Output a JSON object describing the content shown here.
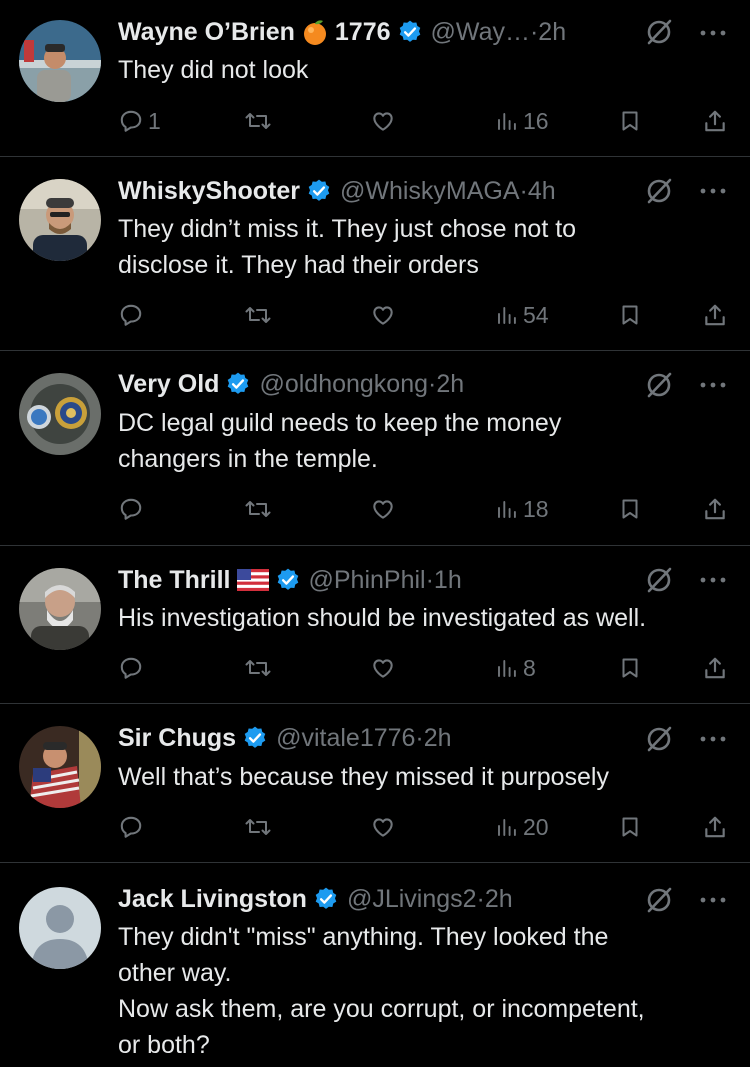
{
  "colors": {
    "background": "#000000",
    "text": "#e7e9ea",
    "muted": "#71767b",
    "verified": "#1d9bf0",
    "divider": "#2f3336"
  },
  "tweets": [
    {
      "name": "Wayne O’Brien",
      "name_extra": "1776",
      "name_emoji": "orange-emoji",
      "handle_time": "@Way…·2h",
      "lines": [
        "They did not look"
      ],
      "replies": "1",
      "retweets": "",
      "likes": "",
      "views": "16"
    },
    {
      "name": "WhiskyShooter",
      "name_extra": "",
      "name_emoji": "",
      "handle_time": "@WhiskyMAGA·4h",
      "lines": [
        "They didn’t miss it. They just chose not to",
        "disclose it. They had their orders"
      ],
      "replies": "",
      "retweets": "",
      "likes": "",
      "views": "54"
    },
    {
      "name": "Very Old",
      "name_extra": "",
      "name_emoji": "",
      "handle_time": "@oldhongkong·2h",
      "lines": [
        "DC legal guild needs to keep the money",
        "changers in the temple."
      ],
      "replies": "",
      "retweets": "",
      "likes": "",
      "views": "18"
    },
    {
      "name": "The Thrill",
      "name_extra": "",
      "name_emoji": "us-flag-emoji",
      "handle_time": "@PhinPhil·1h",
      "lines": [
        "His investigation should be investigated as well."
      ],
      "replies": "",
      "retweets": "",
      "likes": "",
      "views": "8"
    },
    {
      "name": "Sir Chugs",
      "name_extra": "",
      "name_emoji": "",
      "handle_time": "@vitale1776·2h",
      "lines": [
        "Well that’s because they missed it purposely"
      ],
      "replies": "",
      "retweets": "",
      "likes": "",
      "views": "20"
    },
    {
      "name": "Jack Livingston",
      "name_extra": "",
      "name_emoji": "",
      "handle_time": "@JLivings2·2h",
      "lines": [
        "They didn't \"miss\" anything. They looked the",
        "other way.",
        "Now ask them, are you corrupt, or incompetent,",
        "or both?"
      ],
      "replies": "",
      "retweets": "",
      "likes": "",
      "views": ""
    }
  ]
}
